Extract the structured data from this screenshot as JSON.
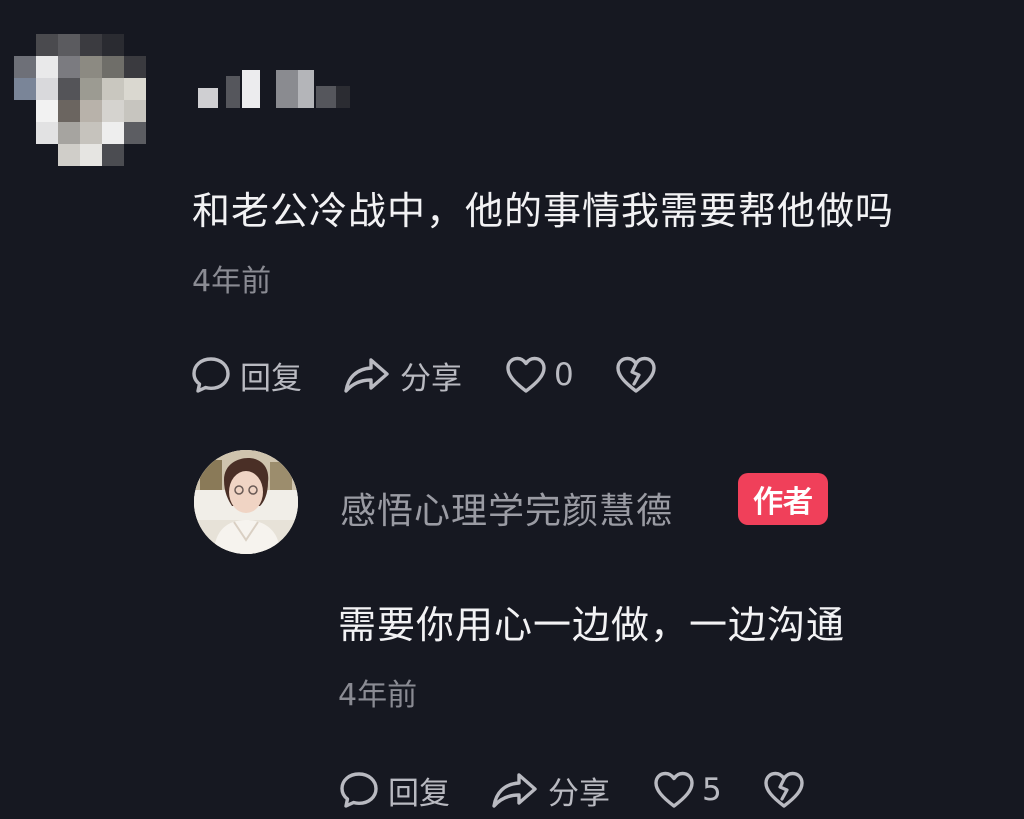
{
  "comment": {
    "text": "和老公冷战中，他的事情我需要帮他做吗",
    "time": "4年前",
    "actions": {
      "reply_label": "回复",
      "share_label": "分享",
      "like_count": "0"
    }
  },
  "reply": {
    "author_name": "感悟心理学完颜慧德",
    "author_badge": "作者",
    "text": "需要你用心一边做，一边沟通",
    "time": "4年前",
    "actions": {
      "reply_label": "回复",
      "share_label": "分享",
      "like_count": "5"
    }
  },
  "icons": {
    "reply": "comment-bubble-icon",
    "share": "share-arrow-icon",
    "like": "heart-icon",
    "dislike": "broken-heart-icon"
  },
  "colors": {
    "background": "#161821",
    "text_primary": "#f2f2f4",
    "text_secondary": "#8a8b93",
    "badge": "#f0405a"
  }
}
